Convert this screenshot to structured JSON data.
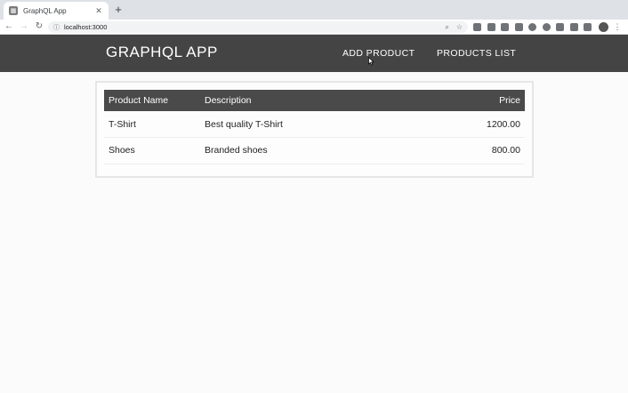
{
  "browser": {
    "tab_title": "GraphQL App",
    "new_tab": "+",
    "url": "localhost:3000"
  },
  "app": {
    "title": "GRAPHQL APP",
    "nav": {
      "add_product": "ADD PRODUCT",
      "products_list": "PRODUCTS LIST"
    }
  },
  "table": {
    "headers": {
      "name": "Product Name",
      "description": "Description",
      "price": "Price"
    },
    "rows": [
      {
        "name": "T-Shirt",
        "description": "Best quality T-Shirt",
        "price": "1200.00"
      },
      {
        "name": "Shoes",
        "description": "Branded shoes",
        "price": "800.00"
      }
    ]
  },
  "colors": {
    "header_bg": "#444444",
    "table_header_bg": "#4a4a4a"
  }
}
